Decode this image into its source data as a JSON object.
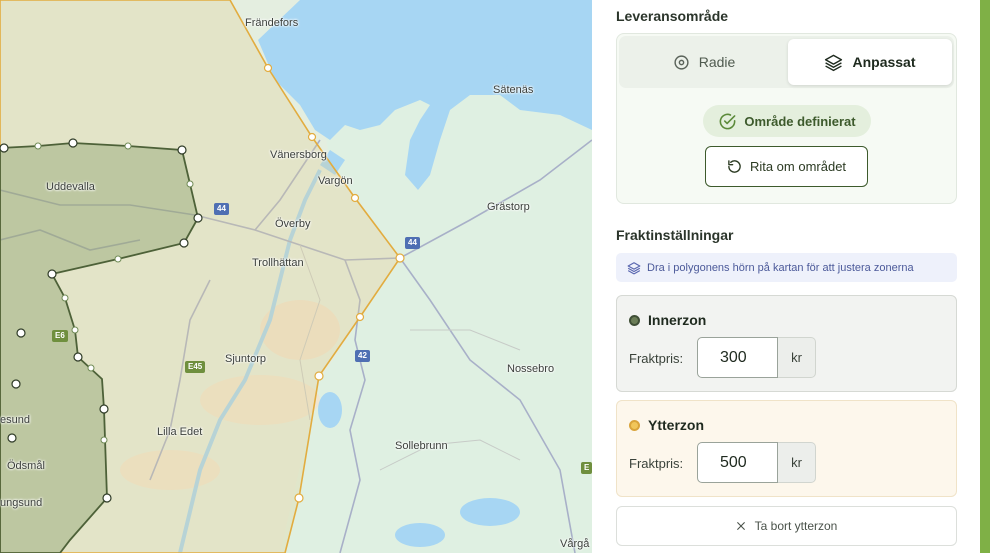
{
  "map": {
    "places": [
      "Frändefors",
      "Sätenäs",
      "Vänersborg",
      "Vargön",
      "Uddevalla",
      "Grästorp",
      "Överby",
      "Trollhättan",
      "Sjuntorp",
      "Nossebro",
      "Lilla Edet",
      "Sollebrunn",
      "esund",
      "Ödsmål",
      "ungsund",
      "Vårgå"
    ],
    "road_shields": [
      "44",
      "44",
      "42",
      "E6",
      "E45",
      "E"
    ]
  },
  "panel": {
    "area_title": "Leveransområde",
    "mode_radius": "Radie",
    "mode_custom": "Anpassat",
    "status": "Område definierat",
    "redraw": "Rita om området",
    "freight_title": "Fraktinställningar",
    "hint": "Dra i polygonens hörn på kartan för att justera zonerna",
    "inner_zone": {
      "name": "Innerzon",
      "price_label": "Fraktpris:",
      "price": "300",
      "unit": "kr",
      "color": "#6b7d57"
    },
    "outer_zone": {
      "name": "Ytterzon",
      "price_label": "Fraktpris:",
      "price": "500",
      "unit": "kr",
      "color": "#f1c65a"
    },
    "remove_outer": "Ta bort ytterzon",
    "accent": "#3d5a2c"
  },
  "icons": [
    "radius-icon",
    "layers-icon",
    "check-circle-icon",
    "redo-icon",
    "layers-icon",
    "close-icon"
  ]
}
